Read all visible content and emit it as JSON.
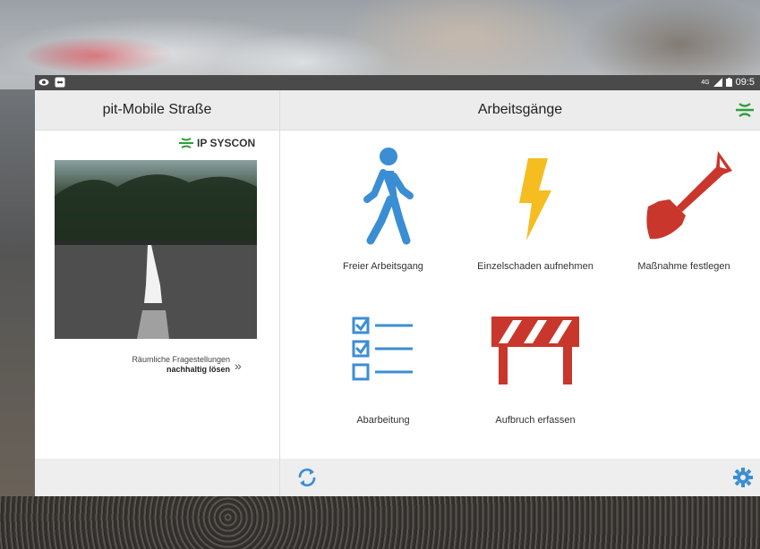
{
  "statusbar": {
    "signal": "4G",
    "time": "09:5"
  },
  "left_panel": {
    "title": "pit-Mobile Straße",
    "logo_text": "IP SYSCON",
    "tagline_line1": "Räumliche Fragestellungen",
    "tagline_line2": "nachhaltig lösen",
    "tagline_chevron": "»"
  },
  "right_panel": {
    "title": "Arbeitsgänge",
    "tiles": [
      {
        "label": "Freier Arbeitsgang",
        "icon": "walking-person-icon"
      },
      {
        "label": "Einzelschaden aufnehmen",
        "icon": "lightning-icon"
      },
      {
        "label": "Maßnahme festlegen",
        "icon": "shovel-icon"
      },
      {
        "label": "Abarbeitung",
        "icon": "checklist-icon"
      },
      {
        "label": "Aufbruch erfassen",
        "icon": "road-barrier-icon"
      }
    ]
  },
  "colors": {
    "blue": "#3b8ed4",
    "yellow": "#f5bd1f",
    "red": "#c9372c",
    "green": "#2e9e3a"
  }
}
